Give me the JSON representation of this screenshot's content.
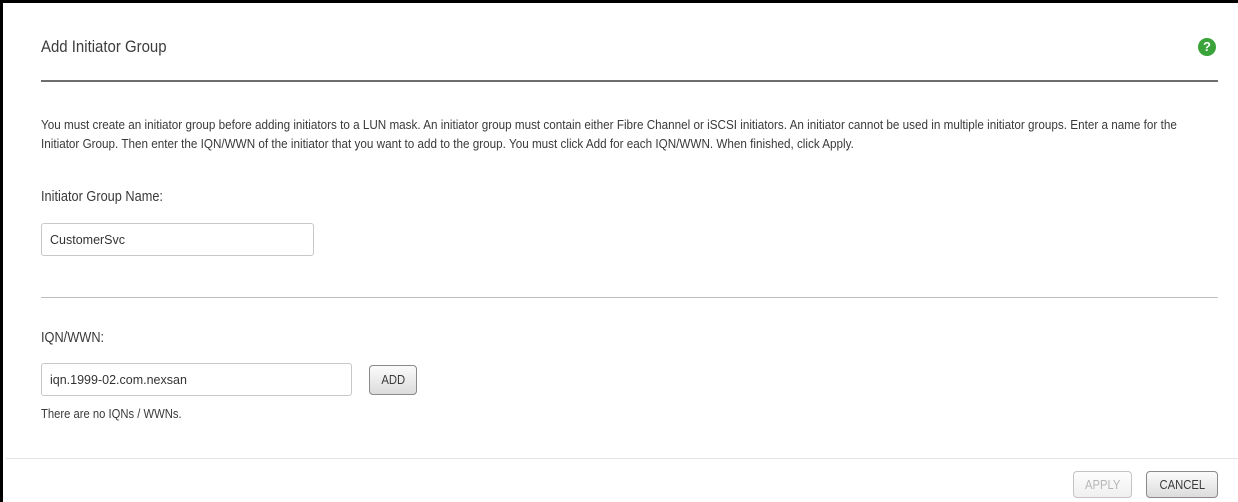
{
  "dialog": {
    "title": "Add Initiator Group",
    "help_icon": "question-mark-circle-icon",
    "help_glyph": "?",
    "description": "You must create an initiator group before adding initiators to a LUN mask. An initiator group must contain either Fibre Channel or iSCSI initiators. An initiator cannot be used in multiple initiator groups. Enter a name for the Initiator Group. Then enter the IQN/WWN of the initiator that you want to add to the group. You must click Add for each IQN/WWN. When finished, click Apply."
  },
  "group_name": {
    "label": "Initiator Group Name:",
    "value": "CustomerSvc"
  },
  "iqn": {
    "label": "IQN/WWN:",
    "value": "iqn.1999-02.com.nexsan",
    "add_label": "ADD",
    "empty_message": "There are no IQNs / WWNs."
  },
  "footer": {
    "apply_label": "APPLY",
    "apply_disabled": true,
    "cancel_label": "CANCEL"
  },
  "colors": {
    "help_icon": "#3aa33a",
    "title_rule": "#6e6e6e",
    "text": "#3a3a3a"
  }
}
